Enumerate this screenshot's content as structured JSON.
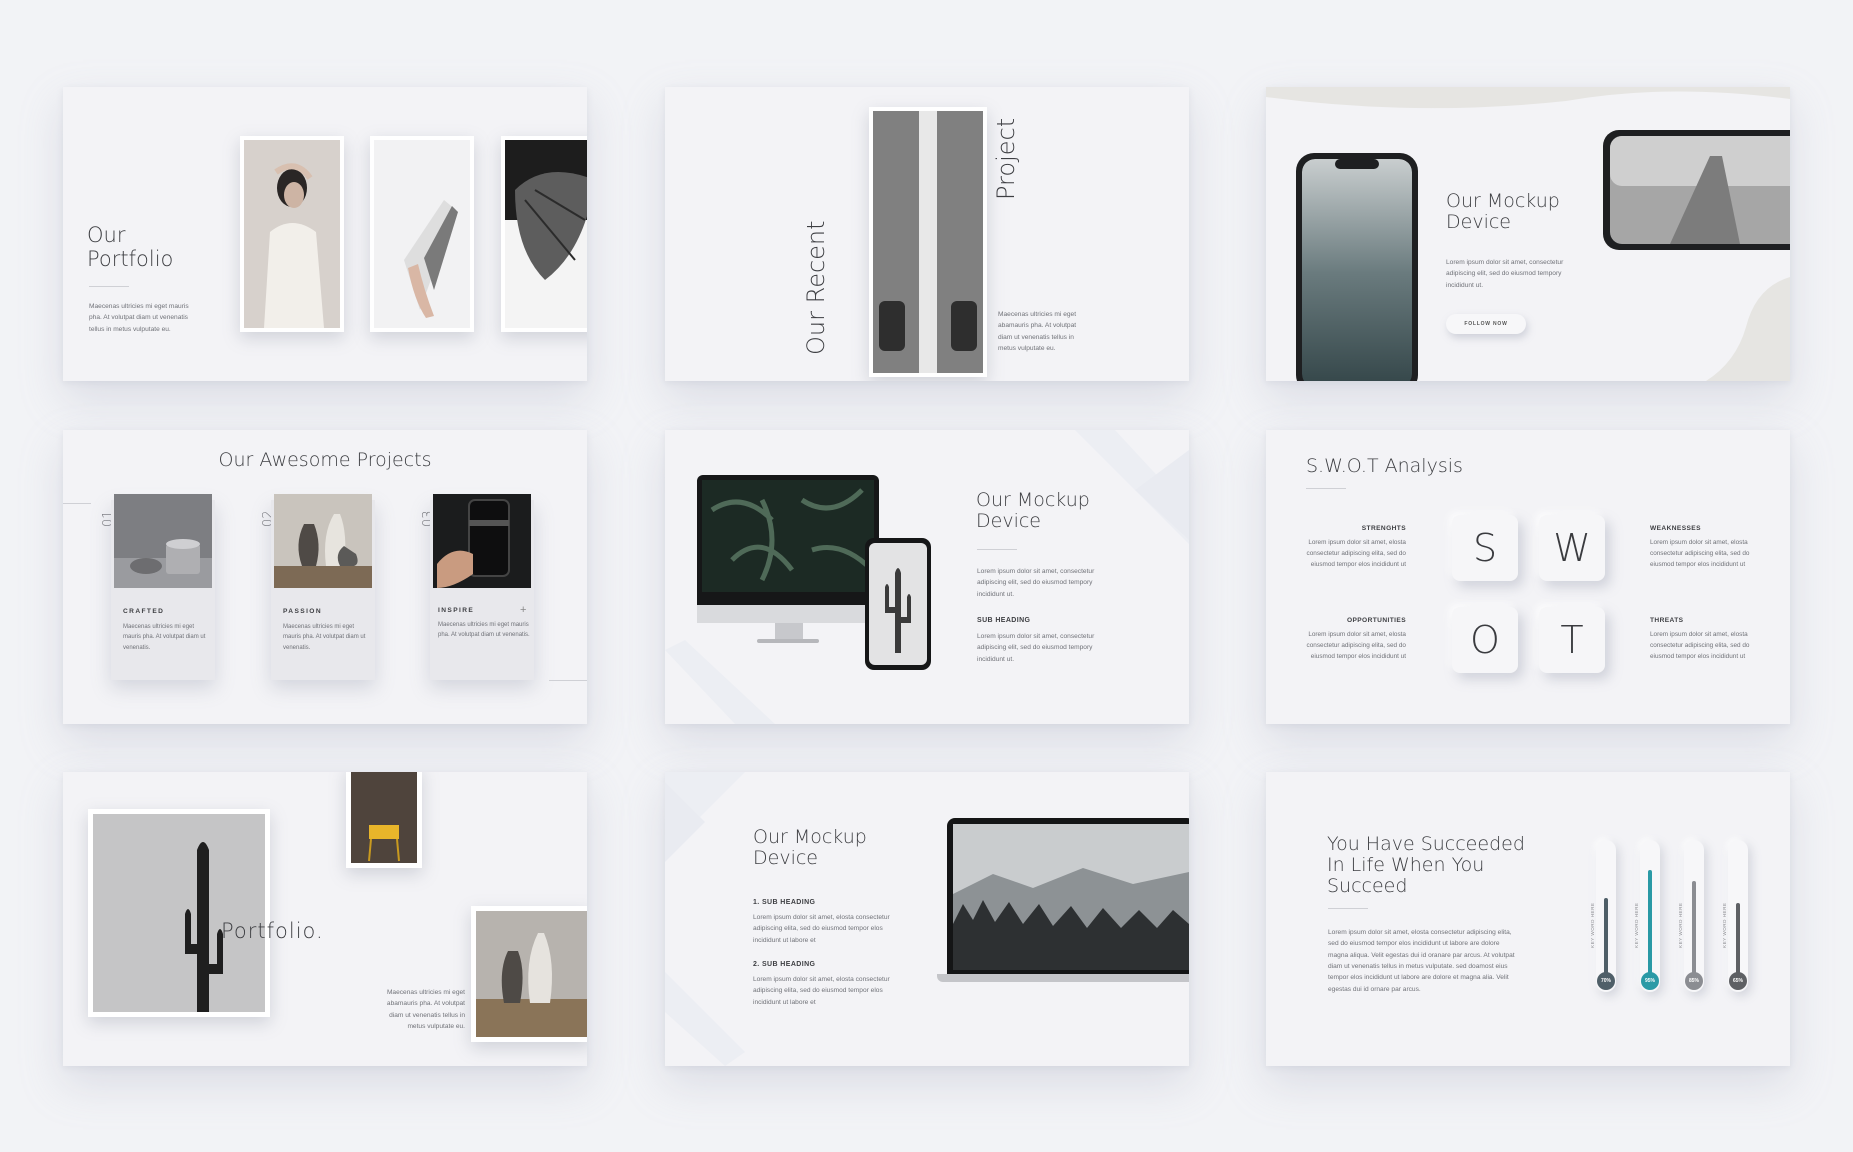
{
  "portfolio": {
    "title_line1": "Our",
    "title_line2": "Portfolio",
    "body": "Maecenas ultricies mi eget mauris pha. At volutpat diam ut venenatis tellus in metus vulputate eu."
  },
  "recent_project": {
    "title_part1": "Our Recent",
    "title_part2": "Project",
    "body": "Maecenas ultricies mi eget abamauris pha. At volutpat diam ut venenatis tellus in metus vulputate eu."
  },
  "mockup_phone": {
    "title_line1": "Our Mockup",
    "title_line2": "Device",
    "body": "Lorem ipsum dolor sit amet, consectetur adipiscing elit, sed do eiusmod tempory incididunt ut.",
    "button": "FOLLOW NOW"
  },
  "projects": {
    "title": "Our Awesome Projects",
    "items": [
      {
        "num": "01.",
        "label": "CRAFTED",
        "body": "Maecenas ultricies mi eget mauris pha. At volutpat diam ut venenatis."
      },
      {
        "num": "02.",
        "label": "PASSION",
        "body": "Maecenas ultricies mi eget mauris pha. At volutpat diam ut venenatis."
      },
      {
        "num": "03.",
        "label": "INSPIRE",
        "body": "Maecenas ultricies mi eget mauris pha. At volutpat diam ut venenatis."
      }
    ],
    "plus": "+"
  },
  "mockup_desktop": {
    "title_line1": "Our Mockup",
    "title_line2": "Device",
    "body1": "Lorem ipsum dolor sit amet, consectetur adipiscing elit, sed do eiusmod tempory incididunt ut.",
    "sub_heading": "SUB HEADING",
    "body2": "Lorem ipsum dolor sit amet, consectetur adipiscing elit, sed do eiusmod tempory incididunt ut."
  },
  "swot": {
    "title": "S.W.O.T Analysis",
    "letters": [
      "S",
      "W",
      "O",
      "T"
    ],
    "items": [
      {
        "heading": "STRENGHTS",
        "body": "Lorem ipsum dolor sit amet, elosta consectetur adipiscing elita, sed do eiusmod tempor elos incididunt ut"
      },
      {
        "heading": "WEAKNESSES",
        "body": "Lorem ipsum dolor sit amet, elosta consectetur adipiscing elita, sed do eiusmod tempor elos incididunt ut"
      },
      {
        "heading": "OPPORTUNITIES",
        "body": "Lorem ipsum dolor sit amet, elosta consectetur adipiscing elita, sed do eiusmod tempor elos incididunt ut"
      },
      {
        "heading": "THREATS",
        "body": "Lorem ipsum dolor sit amet, elosta consectetur adipiscing elita, sed do eiusmod tempor elos incididunt ut"
      }
    ]
  },
  "portfolio2": {
    "title": "Portfolio.",
    "body": "Maecenas ultricies mi eget abamauris pha. At volutpat diam ut venenatis tellus in metus vulputate eu."
  },
  "mockup_laptop": {
    "title_line1": "Our Mockup",
    "title_line2": "Device",
    "sub1": "1. SUB HEADING",
    "body1": "Lorem ipsum dolor sit amet, elosta consectetur adipiscing elita, sed do eiusmod tempor elos incididunt ut labore et",
    "sub2": "2. SUB HEADING",
    "body2": "Lorem ipsum dolor sit amet, elosta consectetur adipiscing elita, sed do eiusmod tempor elos incididunt ut labore et"
  },
  "succeed": {
    "title_line1": "You Have Succeeded",
    "title_line2": "In Life When You",
    "title_line3": "Succeed",
    "body": "Lorem ipsum dolor sit amet, elosta consectetur adipiscing elita, sed do eiusmod tempor elos incididunt ut labore are dolore magna aliqua. Velit egestas dui id oranare par arcus. At volutpat diam ut venenatis tellus in metus vulputate. sed doamost eius tempor elos incididunt ut labore are dolore et magna alia. Velit egestas dui id ornare par arcus.",
    "bars": [
      {
        "keyword": "KEY WORD HERE",
        "percent": 70,
        "label": "70%",
        "color": "#4f5f68"
      },
      {
        "keyword": "KEY WORD HERE",
        "percent": 95,
        "label": "95%",
        "color": "#2a9aa6"
      },
      {
        "keyword": "KEY WORD HERE",
        "percent": 85,
        "label": "85%",
        "color": "#8b8d92"
      },
      {
        "keyword": "KEY WORD HERE",
        "percent": 65,
        "label": "65%",
        "color": "#5e6064"
      }
    ]
  }
}
